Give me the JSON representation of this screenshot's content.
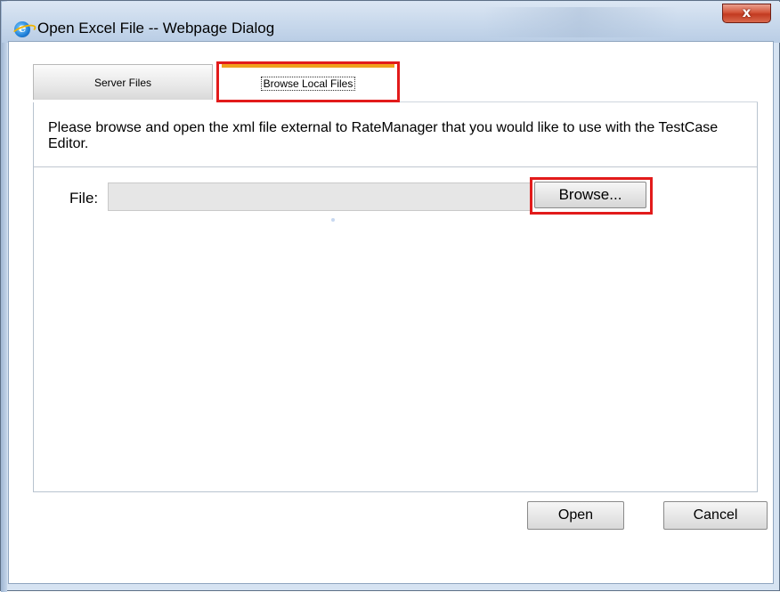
{
  "window": {
    "title": "Open Excel File -- Webpage Dialog",
    "close_label": "x"
  },
  "tabs": [
    {
      "label": "Server Files",
      "selected": false
    },
    {
      "label": "Browse Local Files",
      "selected": true
    }
  ],
  "instructions": "Please browse and open the xml file external to RateManager that you would like to use with the TestCase Editor.",
  "file": {
    "label": "File:",
    "value": "",
    "browse_label": "Browse..."
  },
  "buttons": {
    "open_label": "Open",
    "cancel_label": "Cancel"
  },
  "colors": {
    "highlight": "#e21b1b",
    "selected_tab_accent": "#f0a01e",
    "close_button": "#c23a20"
  },
  "icons": {
    "app": "ie-icon",
    "close": "close-icon"
  }
}
